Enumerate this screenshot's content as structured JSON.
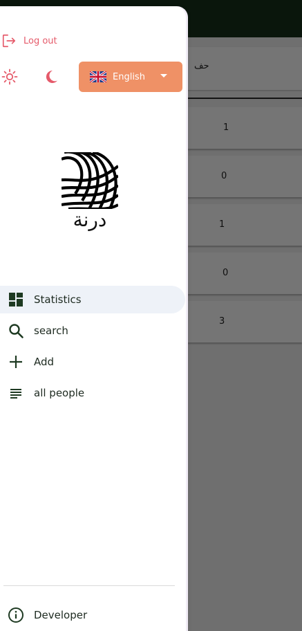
{
  "background": {
    "header_text": "حف",
    "row_values": [
      "1",
      "0",
      "1",
      "0",
      "3"
    ]
  },
  "drawer": {
    "logout_label": "Log out",
    "language": {
      "selected": "English",
      "flag": "uk-flag-icon"
    },
    "logo_text": "درنة",
    "nav_items": [
      {
        "label": "Statistics",
        "icon": "dashboard-icon",
        "active": true
      },
      {
        "label": "search",
        "icon": "search-icon",
        "active": false
      },
      {
        "label": "Add",
        "icon": "plus-icon",
        "active": false
      },
      {
        "label": "all people",
        "icon": "list-icon",
        "active": false
      }
    ],
    "footer_item": {
      "label": "Developer",
      "icon": "info-icon"
    }
  },
  "colors": {
    "accent_orange": "#ef9166",
    "logout_red": "#e55a6a",
    "appbar_green": "#17311c",
    "icon_green": "#1e3a22"
  }
}
